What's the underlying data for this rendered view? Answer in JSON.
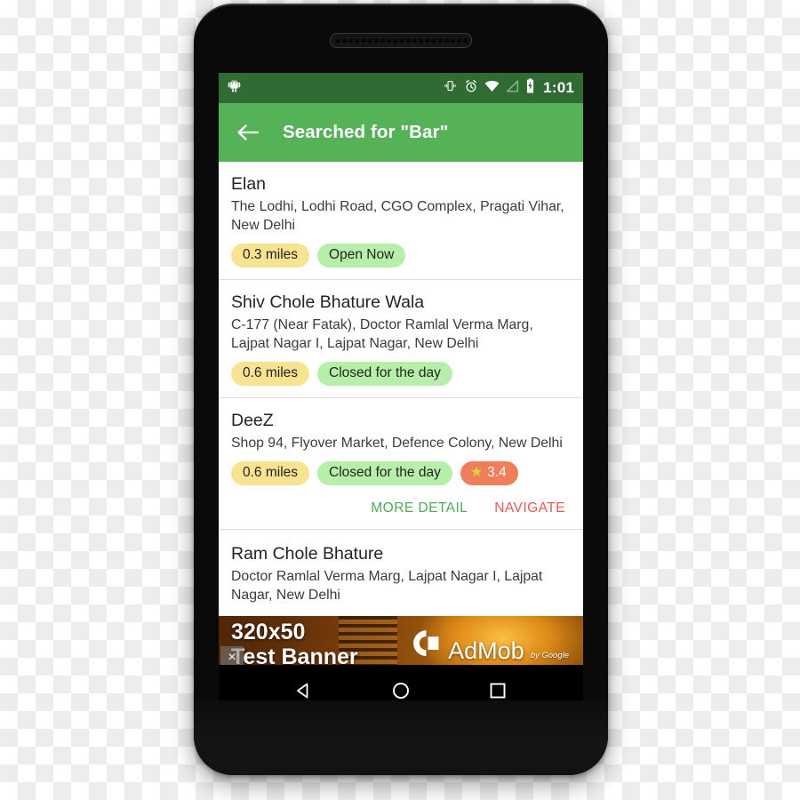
{
  "device": {
    "speaker": "earpiece-speaker-grille"
  },
  "status_bar": {
    "android_icon": "android-robot-icon",
    "icons": [
      "vibrate-icon",
      "alarm-icon",
      "wifi-icon",
      "signal-icon",
      "battery-charging-icon"
    ],
    "time": "1:01",
    "background_color": "#2F6B33"
  },
  "app_bar": {
    "back_icon": "back-arrow-icon",
    "title": "Searched for \"Bar\"",
    "background_color": "#55B256"
  },
  "results": [
    {
      "name": "Elan",
      "address": "The Lodhi, Lodhi Road, CGO Complex, Pragati Vihar, New Delhi",
      "distance": "0.3 miles",
      "status": "Open Now",
      "rating": null,
      "expanded": false
    },
    {
      "name": "Shiv Chole Bhature Wala",
      "address": "C-177 (Near Fatak), Doctor Ramlal Verma Marg, Lajpat Nagar I, Lajpat Nagar, New Delhi",
      "distance": "0.6 miles",
      "status": "Closed for the day",
      "rating": null,
      "expanded": false
    },
    {
      "name": "DeeZ",
      "address": "Shop 94, Flyover Market, Defence Colony, New Delhi",
      "distance": "0.6 miles",
      "status": "Closed for the day",
      "rating": "3.4",
      "expanded": true
    },
    {
      "name": "Ram Chole Bhature",
      "address": "Doctor Ramlal Verma Marg, Lajpat Nagar I, Lajpat Nagar, New Delhi",
      "distance": null,
      "status": null,
      "rating": null,
      "expanded": false
    }
  ],
  "actions": {
    "more_detail": "MORE DETAIL",
    "navigate": "NAVIGATE",
    "more_detail_color": "#4CAF50",
    "navigate_color": "#F4564C"
  },
  "chip_colors": {
    "distance": "#F8E391",
    "status": "#B6EFA9",
    "rating": "#F07E58",
    "star": "#CDDC39"
  },
  "ad": {
    "line1": "320x50",
    "line2": "Test Banner",
    "brand": "AdMob",
    "byline": "by Google",
    "close_label": "×",
    "logo_icon": "admob-logo-icon"
  },
  "nav_bar": {
    "back": "nav-back-triangle-icon",
    "home": "nav-home-circle-icon",
    "recents": "nav-recents-square-icon"
  }
}
